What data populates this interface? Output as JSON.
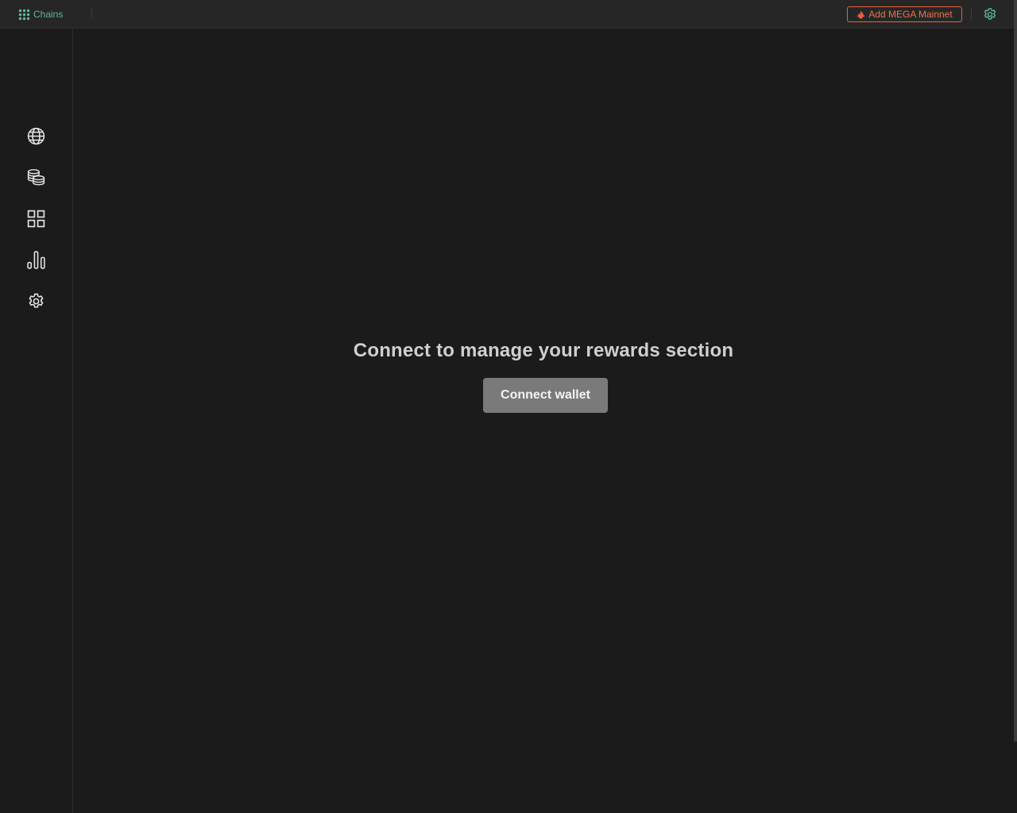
{
  "topbar": {
    "chains_label": "Chains",
    "add_mainnet_label": "Add MEGA Mainnet",
    "accent_color": "#5fb89a",
    "mainnet_color": "#e8613a",
    "icons": {
      "chains": "grid-dots-icon",
      "mainnet": "flame-icon",
      "settings": "gear-icon"
    }
  },
  "sidebar": {
    "items": [
      {
        "icon": "globe-icon"
      },
      {
        "icon": "coins-stack-icon"
      },
      {
        "icon": "dashboard-grid-icon"
      },
      {
        "icon": "bar-chart-icon"
      },
      {
        "icon": "gear-icon"
      }
    ]
  },
  "main": {
    "title": "Connect to manage your rewards section",
    "connect_label": "Connect wallet"
  }
}
